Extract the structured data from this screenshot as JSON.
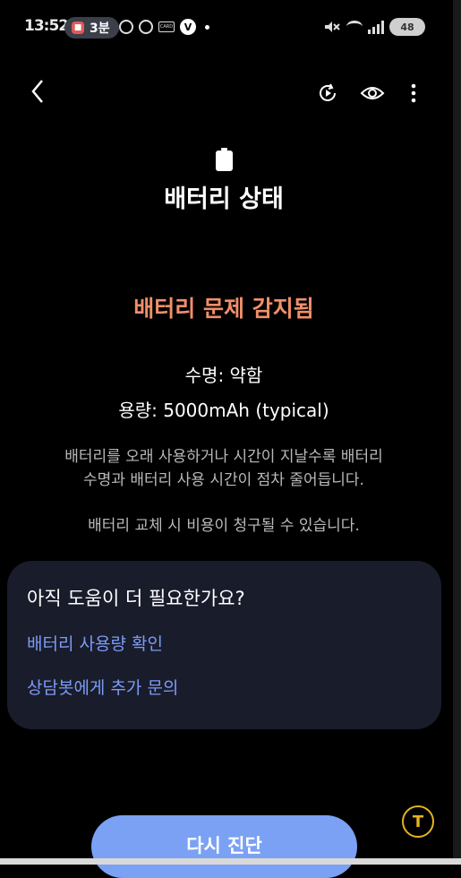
{
  "status_bar": {
    "time": "13:52",
    "notification_pill": "3분",
    "battery_level": "48"
  },
  "header": {
    "back_icon": "chevron-left-icon",
    "actions": [
      "replay-icon",
      "eye-icon",
      "more-vertical-icon"
    ]
  },
  "page": {
    "title": "배터리 상태",
    "warning": "배터리 문제 감지됨",
    "lifespan": "수명: 약함",
    "capacity": "용량: 5000mAh (typical)",
    "description_line1": "배터리를 오래 사용하거나 시간이 지날수록 배터리",
    "description_line2": "수명과 배터리 사용 시간이 점차 줄어듭니다.",
    "replace_notice": "배터리 교체 시 비용이 청구될 수 있습니다."
  },
  "help_card": {
    "question": "아직 도움이 더 필요한가요?",
    "link_usage": "배터리 사용량 확인",
    "link_chatbot": "상담봇에게 추가 문의"
  },
  "floating_button": {
    "label": "T"
  },
  "actions": {
    "rediagnose": "다시 진단"
  },
  "colors": {
    "background": "#000000",
    "warning": "#f08f6a",
    "link": "#7c9bf5",
    "card": "#191c2b",
    "primary_button": "#7aa1f4",
    "float_accent": "#e6b31e"
  }
}
